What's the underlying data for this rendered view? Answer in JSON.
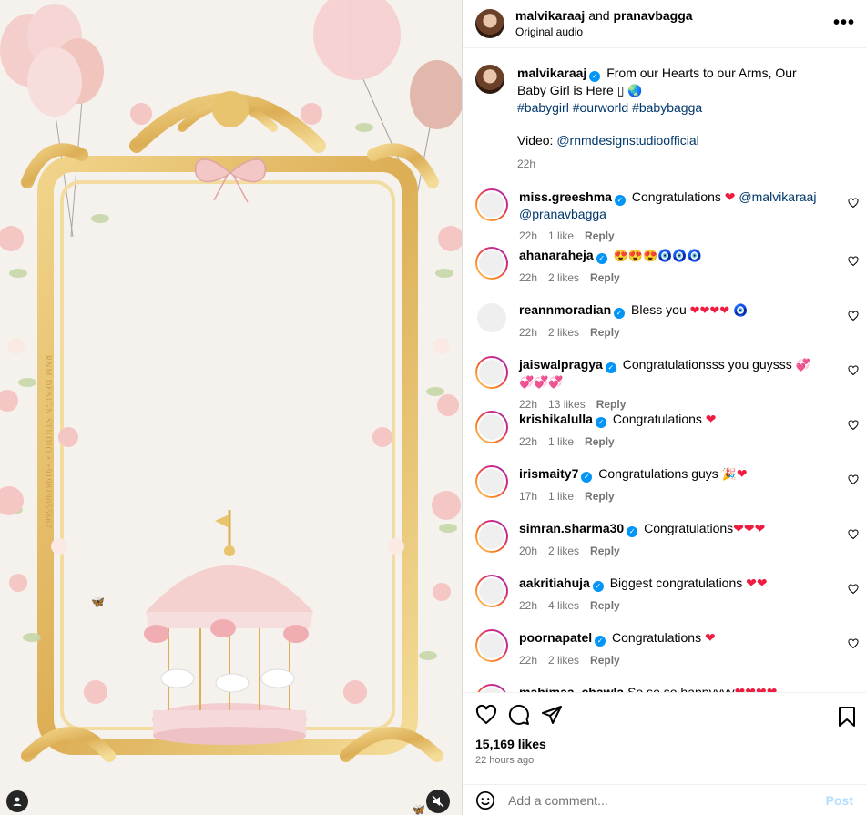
{
  "post": {
    "author": "malvikaraaj",
    "coauthor": "pranavbagga",
    "conjunction": "and",
    "audio": "Original audio",
    "caption": {
      "username": "malvikaraaj",
      "text": "From our Hearts to our Arms, Our Baby Girl is Here",
      "hashtags": "#babygirl #ourworld #babybagga",
      "video_label": "Video:",
      "video_credit": "@rnmdesignstudioofficial",
      "time": "22h"
    }
  },
  "comments": [
    {
      "user": "miss.greeshma",
      "text": "Congratulations",
      "mention1": "@malvikaraaj",
      "mention2": "@pranavbagga",
      "time": "22h",
      "likes": "1 like",
      "reply": "Reply",
      "avatar": "ring"
    },
    {
      "user": "ahanaraheja",
      "text": "",
      "time": "22h",
      "likes": "2 likes",
      "reply": "Reply",
      "avatar": "ring"
    },
    {
      "user": "reannmoradian",
      "text": "Bless you",
      "time": "22h",
      "likes": "2 likes",
      "reply": "Reply",
      "avatar": "plain"
    },
    {
      "user": "jaiswalpragya",
      "text": "Congratulationsss you guysss",
      "time": "22h",
      "likes": "13 likes",
      "reply": "Reply",
      "avatar": "ring"
    },
    {
      "user": "krishikalulla",
      "text": "Congratulations",
      "time": "22h",
      "likes": "1 like",
      "reply": "Reply",
      "avatar": "ring"
    },
    {
      "user": "irismaity7",
      "text": "Congratulations guys",
      "time": "17h",
      "likes": "1 like",
      "reply": "Reply",
      "avatar": "ring"
    },
    {
      "user": "simran.sharma30",
      "text": "Congratulations",
      "time": "20h",
      "likes": "2 likes",
      "reply": "Reply",
      "avatar": "ring"
    },
    {
      "user": "aakritiahuja",
      "text": "Biggest congratulations",
      "time": "22h",
      "likes": "4 likes",
      "reply": "Reply",
      "avatar": "ring"
    },
    {
      "user": "poornapatel",
      "text": "Congratulations",
      "time": "22h",
      "likes": "2 likes",
      "reply": "Reply",
      "avatar": "ring"
    },
    {
      "user": "mahimaa_chawla",
      "text": "So so so happyyyy",
      "time": "",
      "likes": "",
      "reply": "",
      "avatar": "ring"
    }
  ],
  "stats": {
    "likes": "15,169 likes",
    "ago": "22 hours ago"
  },
  "composer": {
    "placeholder": "Add a comment...",
    "post": "Post"
  },
  "media": {
    "watermark": "RNM DESIGN STUDIO • +919819055667"
  },
  "icons": [
    "more-icon",
    "heart-icon",
    "comment-icon",
    "share-icon",
    "save-icon",
    "emoji-icon",
    "user-tag-icon",
    "mute-icon",
    "verified-icon"
  ],
  "colors": {
    "link": "#00376b",
    "verified": "#0095f6",
    "muted": "#737373",
    "post_disabled": "#b2dffc",
    "gold": "#e2b95a"
  }
}
